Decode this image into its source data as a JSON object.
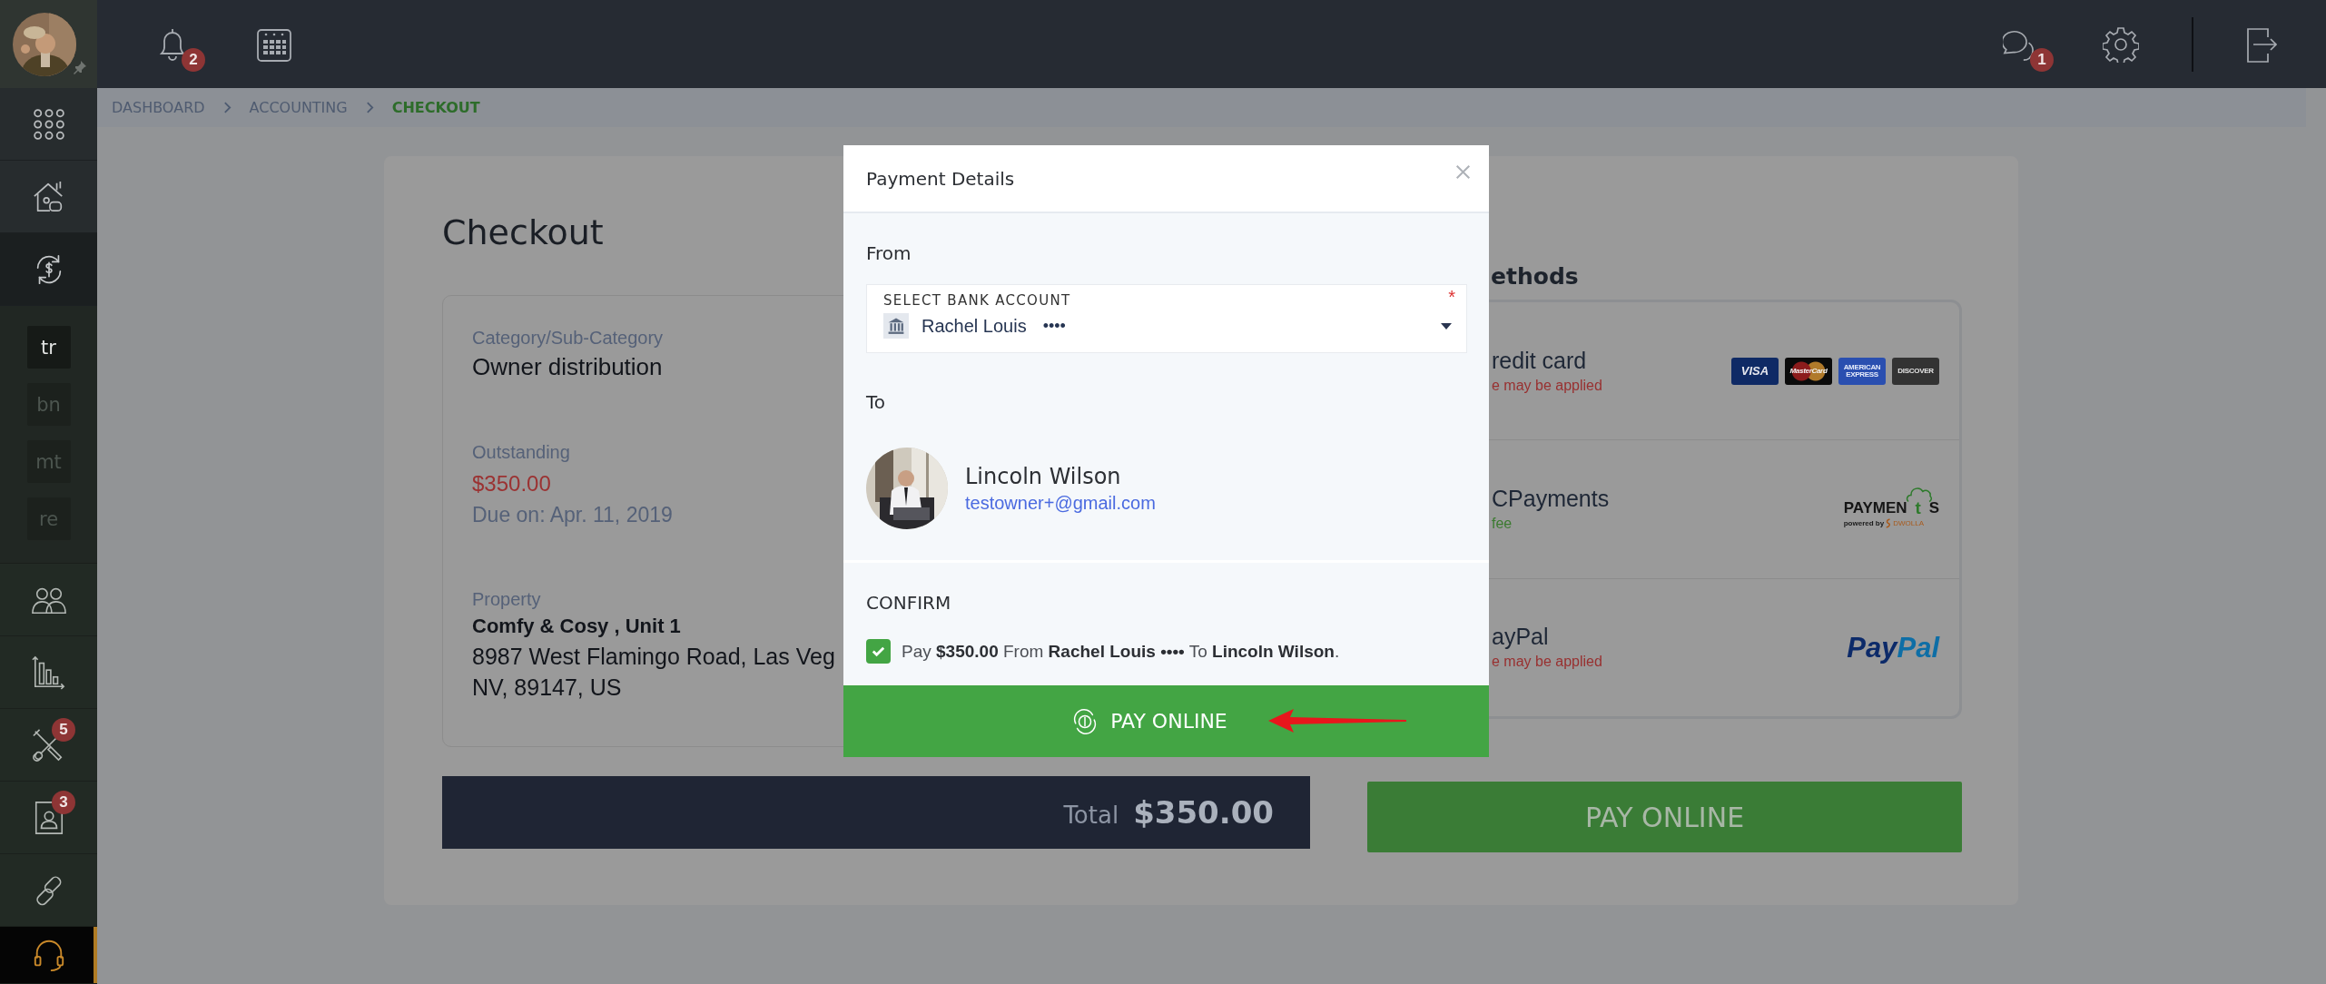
{
  "top_bar": {
    "notifications_badge": "2",
    "messages_badge": "1"
  },
  "sidebar": {
    "nav": [
      {
        "selected": false
      },
      {
        "selected": false
      },
      {
        "selected": true
      }
    ],
    "shortcuts": [
      {
        "label": "tr",
        "selected": true
      },
      {
        "label": "bn",
        "selected": false
      },
      {
        "label": "mt",
        "selected": false
      },
      {
        "label": "re",
        "selected": false
      }
    ],
    "menu": [
      {
        "selected": false
      },
      {
        "selected": false
      },
      {
        "selected": false,
        "badge": "5"
      },
      {
        "selected": false,
        "badge": "3"
      },
      {
        "selected": false
      },
      {
        "selected": true
      }
    ]
  },
  "breadcrumb": [
    {
      "label": "DASHBOARD",
      "selected": false
    },
    {
      "label": "ACCOUNTING",
      "selected": false
    },
    {
      "label": "CHECKOUT",
      "selected": true
    }
  ],
  "checkout": {
    "title": "Checkout",
    "category_label": "Category/Sub-Category",
    "category": "Owner distribution",
    "outstanding_label": "Outstanding",
    "outstanding": "$350.00",
    "due": "Due on: Apr. 11, 2019",
    "property_label": "Property",
    "property_name": "Comfy & Cosy , Unit 1",
    "address": [
      "8987 West Flamingo Road, Las Veg",
      "NV, 89147, US"
    ],
    "total_label": "Total",
    "total": "$350.00",
    "pay_button": "PAY ONLINE"
  },
  "methods": {
    "heading": "ethods",
    "items": [
      {
        "title": "redit card",
        "note": "e may be applied",
        "no_fee": false,
        "logo": {
          "kind": "cards",
          "parts": [
            "VISA",
            "MasterCard",
            "AMERICAN EXPRESS",
            "DISCOVER"
          ]
        }
      },
      {
        "title": "CPayments",
        "note": "fee",
        "no_fee": true,
        "logo": {
          "kind": "payments",
          "parts": [
            "PAYMEN",
            "t",
            "S",
            "powered by",
            "DWOLLA"
          ]
        }
      },
      {
        "title": "ayPal",
        "note": "e may be applied",
        "no_fee": false,
        "logo": {
          "kind": "paypal",
          "parts": [
            "Pay",
            "Pal"
          ]
        }
      }
    ]
  },
  "modal": {
    "title": "Payment Details",
    "from_label": "From",
    "select": {
      "label": "SELECT BANK ACCOUNT",
      "required_mark": "*",
      "value": "Rachel Louis",
      "mask": "••••"
    },
    "to_label": "To",
    "recipient": {
      "name": "Lincoln Wilson",
      "email": "testowner+@gmail.com"
    },
    "confirm_label": "CONFIRM",
    "confirm": {
      "checked": true,
      "text": "Pay **$350.00** From **Rachel Louis ••••** To **Lincoln Wilson**."
    },
    "button": "PAY ONLINE"
  }
}
